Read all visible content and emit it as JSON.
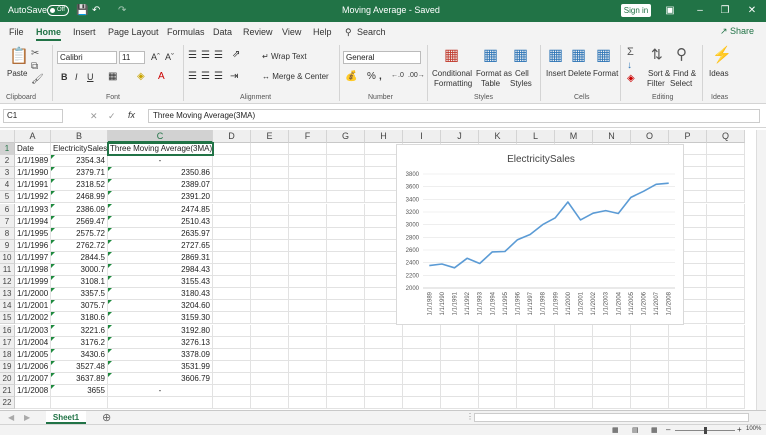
{
  "title": {
    "autosave": "AutoSave",
    "toggle": "Off",
    "doc": "Moving Average - Saved",
    "signin": "Sign in"
  },
  "tabs": [
    "File",
    "Home",
    "Insert",
    "Page Layout",
    "Formulas",
    "Data",
    "Review",
    "View",
    "Help",
    "Search"
  ],
  "share": "Share",
  "ribbon": {
    "paste": "Paste",
    "font_name": "Calibri",
    "font_size": "11",
    "wrap": "Wrap Text",
    "merge": "Merge & Center",
    "number_format": "General",
    "cond_fmt": "Conditional",
    "cond_fmt2": "Formatting",
    "fmt_table": "Format as",
    "fmt_table2": "Table",
    "cell_styles": "Cell",
    "cell_styles2": "Styles",
    "insert": "Insert",
    "delete": "Delete",
    "format": "Format",
    "sort": "Sort &",
    "sort2": "Filter",
    "find": "Find &",
    "find2": "Select",
    "ideas": "Ideas",
    "groups": {
      "clipboard": "Clipboard",
      "font": "Font",
      "alignment": "Alignment",
      "number": "Number",
      "styles": "Styles",
      "cells": "Cells",
      "editing": "Editing",
      "ideas": "Ideas"
    }
  },
  "namebox": "C1",
  "formula": "Three Moving Average(3MA)",
  "columns": [
    "A",
    "B",
    "C",
    "D",
    "E",
    "F",
    "G",
    "H",
    "I",
    "J",
    "K",
    "L",
    "M",
    "N",
    "O",
    "P",
    "Q"
  ],
  "rows": [
    [
      "Date",
      "ElectricitySales",
      "Three Moving Average(3MA)"
    ],
    [
      "1/1/1989",
      "2354.34",
      "-"
    ],
    [
      "1/1/1990",
      "2379.71",
      "2350.86"
    ],
    [
      "1/1/1991",
      "2318.52",
      "2389.07"
    ],
    [
      "1/1/1992",
      "2468.99",
      "2391.20"
    ],
    [
      "1/1/1993",
      "2386.09",
      "2474.85"
    ],
    [
      "1/1/1994",
      "2569.47",
      "2510.43"
    ],
    [
      "1/1/1995",
      "2575.72",
      "2635.97"
    ],
    [
      "1/1/1996",
      "2762.72",
      "2727.65"
    ],
    [
      "1/1/1997",
      "2844.5",
      "2869.31"
    ],
    [
      "1/1/1998",
      "3000.7",
      "2984.43"
    ],
    [
      "1/1/1999",
      "3108.1",
      "3155.43"
    ],
    [
      "1/1/2000",
      "3357.5",
      "3180.43"
    ],
    [
      "1/1/2001",
      "3075.7",
      "3204.60"
    ],
    [
      "1/1/2002",
      "3180.6",
      "3159.30"
    ],
    [
      "1/1/2003",
      "3221.6",
      "3192.80"
    ],
    [
      "1/1/2004",
      "3176.2",
      "3276.13"
    ],
    [
      "1/1/2005",
      "3430.6",
      "3378.09"
    ],
    [
      "1/1/2006",
      "3527.48",
      "3531.99"
    ],
    [
      "1/1/2007",
      "3637.89",
      "3606.79"
    ],
    [
      "1/1/2008",
      "3655",
      "-"
    ],
    [
      "",
      "",
      ""
    ]
  ],
  "sheet_tab": "Sheet1",
  "zoom": "100%",
  "colors": {
    "accent": "#217346",
    "line": "#5b9bd5"
  },
  "chart_data": {
    "type": "line",
    "title": "ElectricitySales",
    "categories": [
      "1/1/1989",
      "1/1/1990",
      "1/1/1991",
      "1/1/1992",
      "1/1/1993",
      "1/1/1994",
      "1/1/1995",
      "1/1/1996",
      "1/1/1997",
      "1/1/1998",
      "1/1/1999",
      "1/1/2000",
      "1/1/2001",
      "1/1/2002",
      "1/1/2003",
      "1/1/2004",
      "1/1/2005",
      "1/1/2006",
      "1/1/2007",
      "1/1/2008"
    ],
    "series": [
      {
        "values": [
          2354.34,
          2379.71,
          2318.52,
          2468.99,
          2386.09,
          2569.47,
          2575.72,
          2762.72,
          2844.5,
          3000.7,
          3108.1,
          3357.5,
          3075.7,
          3180.6,
          3221.6,
          3176.2,
          3430.6,
          3527.48,
          3637.89,
          3655
        ]
      }
    ],
    "yticks": [
      2000,
      2200,
      2400,
      2600,
      2800,
      3000,
      3200,
      3400,
      3600,
      3800
    ],
    "ylim": [
      2000,
      3800
    ],
    "grid": true
  }
}
